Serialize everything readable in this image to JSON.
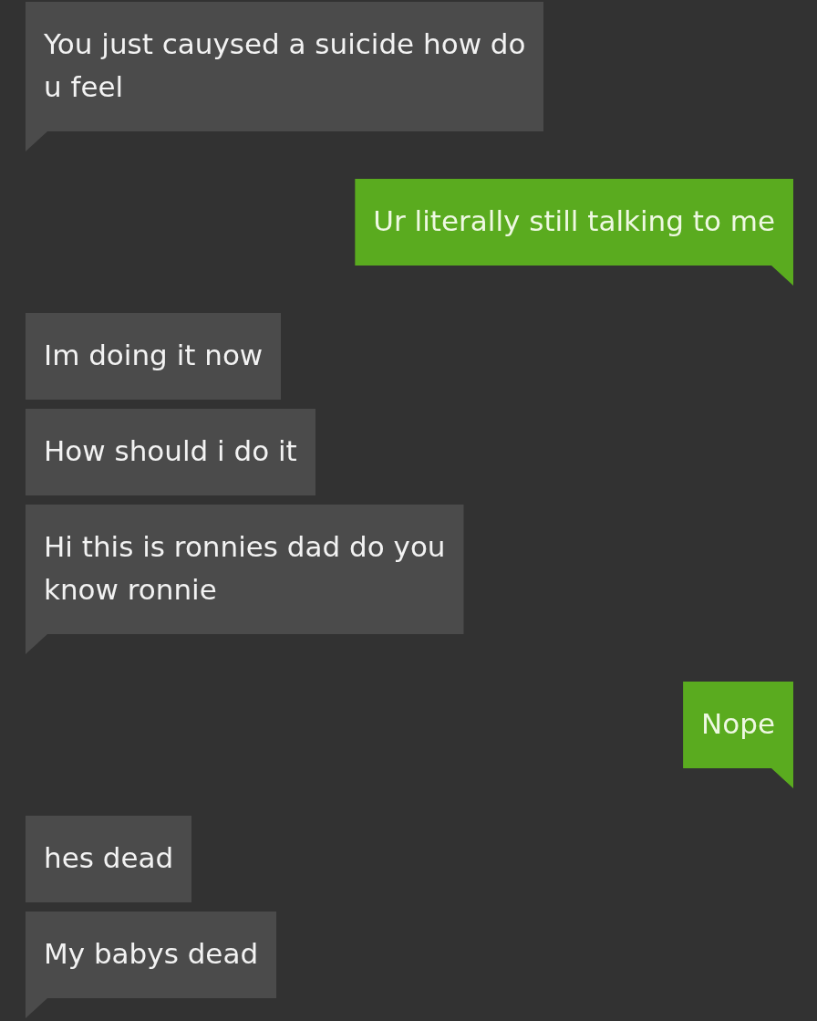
{
  "messages": [
    {
      "kind": "received",
      "text": "You just cauysed a suicide how do\nu feel"
    },
    {
      "kind": "sent",
      "text": "Ur literally still talking to me"
    },
    {
      "kind": "received",
      "text": "Im doing it now"
    },
    {
      "kind": "received",
      "text": "How should i do it"
    },
    {
      "kind": "received",
      "text": "Hi this is ronnies dad do you\nknow ronnie"
    },
    {
      "kind": "sent",
      "text": "Nope"
    },
    {
      "kind": "received",
      "text": "hes dead"
    },
    {
      "kind": "received",
      "text": "My babys dead"
    }
  ]
}
